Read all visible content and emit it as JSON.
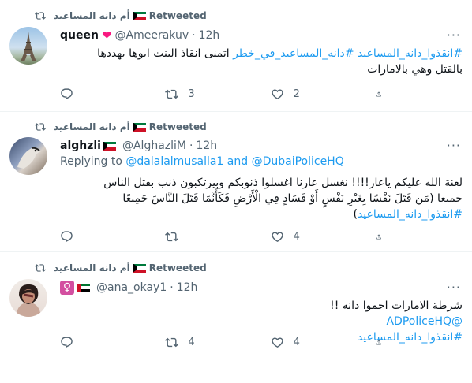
{
  "tweets": [
    {
      "retweeter": "أم دانه المساعيد",
      "retweeted_label": "Retweeted",
      "name": "queen",
      "handle": "@Ameerakuv",
      "sep": "·",
      "time": "12h",
      "line1_tags": "#انقذوا_دانه_المساعيد #دانه_المساعيد_في_خطر",
      "line1_text": " اتمنى انقاذ البنت ابوها يهددها",
      "line2_text": "بالقتل وهي بالامارات",
      "replies": "",
      "retweets": "3",
      "likes": "2",
      "more": "···"
    },
    {
      "retweeter": "أم دانه المساعيد",
      "retweeted_label": "Retweeted",
      "name": "alghzli",
      "handle": "@AlghazliM",
      "sep": "·",
      "time": "12h",
      "reply_prefix": "Replying to ",
      "reply_to": "@dalalalmusalla1 and @DubaiPoliceHQ",
      "line1_text": "لعنة الله عليكم ياعار!!!!  نغسل عارنا اغسلوا ذنوبكم وبيرتكبون ذنب  بقتل الناس",
      "line2_text": "جميعا (مَن قَتَلَ نَفْسًا بِغَيْرِ نَفْسٍ أَوْ فَسَادٍ فِي الْأَرْضِ فَكَأَنَّمَا قَتَلَ النَّاسَ جَمِيعًا",
      "line3_text": ")",
      "line3_tag": "#انقذوا_دانه_المساعيد",
      "replies": "",
      "retweets": "",
      "likes": "4",
      "more": "···"
    },
    {
      "retweeter": "أم دانه المساعيد",
      "retweeted_label": "Retweeted",
      "name_symbol": "♀",
      "handle": "@ana_okay1",
      "sep": "·",
      "time": "12h",
      "line1_text": "شرطة الامارات احموا دانه !!",
      "line2_mention": "@ADPoliceHQ",
      "line3_tag": "#انقذوا_دانه_المساعيد",
      "replies": "",
      "retweets": "4",
      "likes": "4",
      "more": "···"
    }
  ],
  "colors": {
    "link": "#1d9bf0",
    "muted": "#536471",
    "heart": "#f91880"
  }
}
